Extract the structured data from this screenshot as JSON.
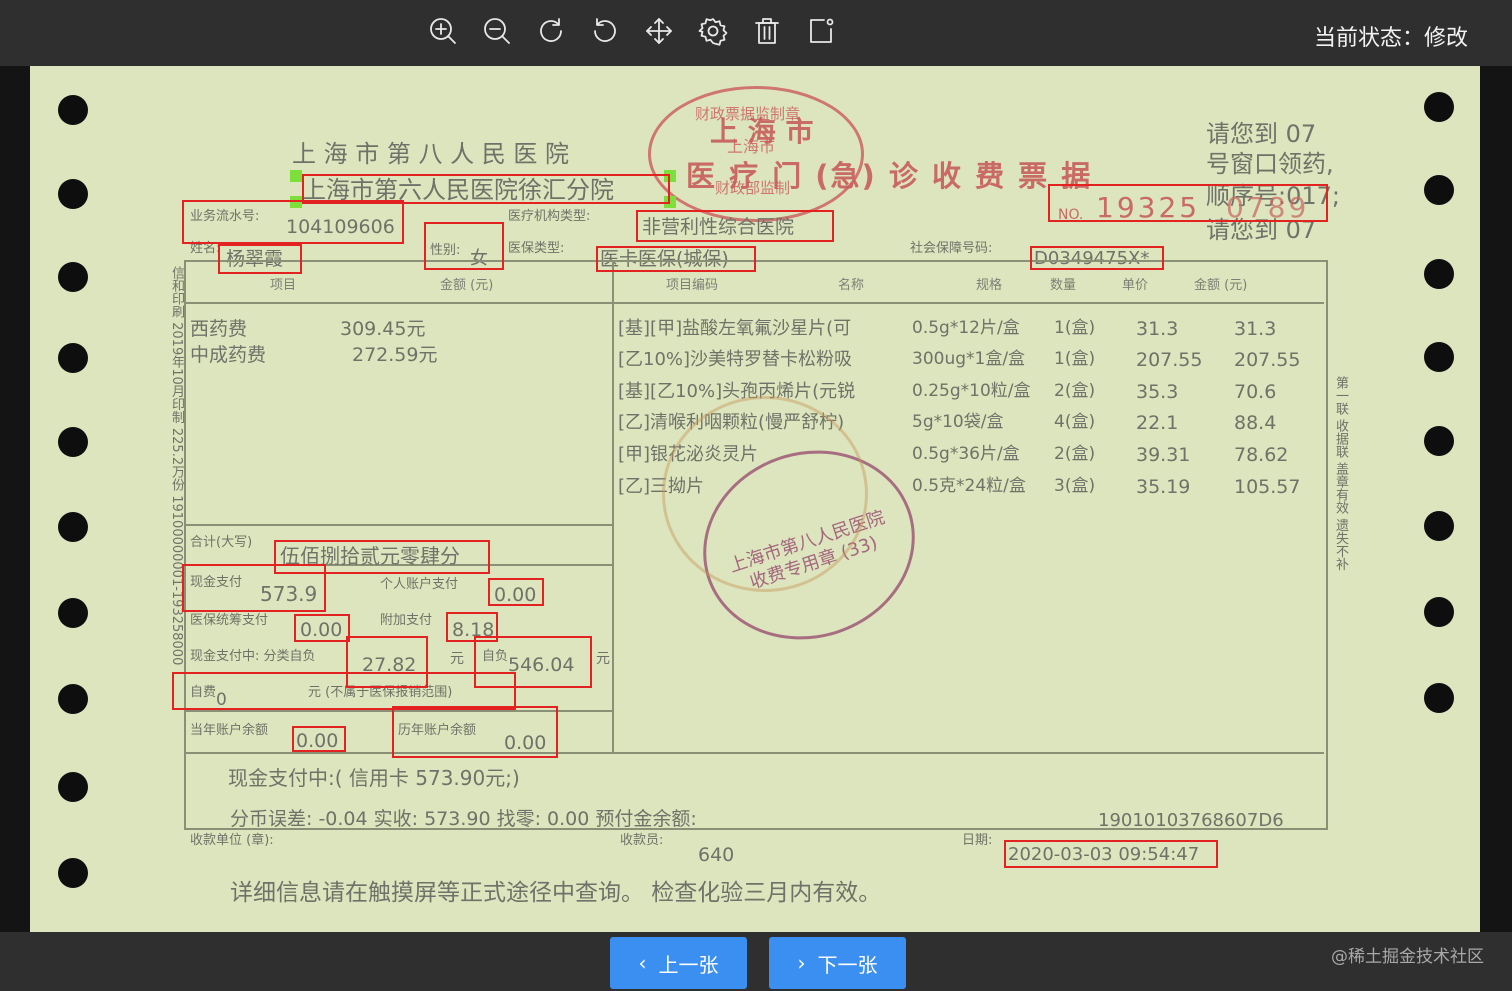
{
  "toolbar": {
    "icons": [
      "zoom-in-icon",
      "zoom-out-icon",
      "rotate-clockwise-icon",
      "rotate-counterclockwise-icon",
      "move-icon",
      "settings-icon",
      "delete-icon",
      "edit-icon"
    ],
    "status_label": "当前状态：修改"
  },
  "receipt": {
    "hospital_name": "上 海 市 第 八 人 民 医 院",
    "branch_name": "上海市第六人民医院徐汇分院",
    "title": "医 疗 门 (急) 诊 收 费 票 据",
    "city_stamp_top": "财政票据监制章",
    "city_stamp_mid": "上海市",
    "city_stamp_bot": "财政部监制",
    "city_word": "上 海 市",
    "no_label": "NO.",
    "no_value": "19325",
    "no_value_tail": "0789",
    "window_note_1": "请您到 07",
    "window_note_2": "号窗口领药,",
    "window_note_3": "顺序号:017;",
    "window_note_4": "请您到 07",
    "serial_label": "业务流水号:",
    "serial_value": "104109606",
    "inst_type_label": "医疗机构类型:",
    "inst_type_value": "非营利性综合医院",
    "name_label": "姓名:",
    "name_value": "杨翠霞",
    "gender_label": "性别:",
    "gender_value": "女",
    "insurance_type_label": "医保类型:",
    "insurance_type_value": "医卡医保(城保)",
    "social_no_label": "社会保障号码:",
    "social_no_value": "D0349475X*",
    "left_headers": [
      "项目",
      "金额 (元)"
    ],
    "right_headers": [
      "项目编码",
      "名称",
      "规格",
      "数量",
      "单价",
      "金额 (元)"
    ],
    "fee_items": [
      {
        "name": "西药费",
        "amount": "309.45元"
      },
      {
        "name": "中成药费",
        "amount": "272.59元"
      }
    ],
    "drug_rows": [
      {
        "name": "[基][甲]盐酸左氧氟沙星片(可",
        "spec": "0.5g*12片/盒",
        "qty": "1(盒)",
        "price": "31.3",
        "amount": "31.3"
      },
      {
        "name": "[乙10%]沙美特罗替卡松粉吸",
        "spec": "300ug*1盒/盒",
        "qty": "1(盒)",
        "price": "207.55",
        "amount": "207.55"
      },
      {
        "name": "[基][乙10%]头孢丙烯片(元锐",
        "spec": "0.25g*10粒/盒",
        "qty": "2(盒)",
        "price": "35.3",
        "amount": "70.6"
      },
      {
        "name": "[乙]清喉利咽颗粒(慢严舒柠)",
        "spec": "5g*10袋/盒",
        "qty": "4(盒)",
        "price": "22.1",
        "amount": "88.4"
      },
      {
        "name": "[甲]银花泌炎灵片",
        "spec": "0.5g*36片/盒",
        "qty": "2(盒)",
        "price": "39.31",
        "amount": "78.62"
      },
      {
        "name": "[乙]三拗片",
        "spec": "0.5克*24粒/盒",
        "qty": "3(盒)",
        "price": "35.19",
        "amount": "105.57"
      }
    ],
    "total_caps_label": "合计(大写)",
    "total_caps_value": "伍佰捌拾贰元零肆分",
    "cash_label": "现金支付",
    "cash_value": "573.9",
    "personal_acct_label": "个人账户支付",
    "personal_acct_value": "0.00",
    "insurance_pay_label": "医保统筹支付",
    "insurance_pay_value": "0.00",
    "additional_label": "附加支付",
    "additional_value": "8.18",
    "cash_in_label": "现金支付中: 分类自负",
    "class_self_value": "27.82",
    "yuan": "元",
    "self_label": "自负",
    "self_value": "546.04",
    "self_pay_label": "自费",
    "self_pay_value": "0",
    "self_pay_note": "元 (不属于医保报销范围)",
    "curr_acct_label": "当年账户余额",
    "curr_acct_value": "0.00",
    "prev_acct_label": "历年账户余额",
    "prev_acct_value": "0.00",
    "cash_note": "现金支付中:( 信用卡  573.90元;)",
    "rounding_note": "分币误差: -0.04 实收: 573.90  找零: 0.00 预付金余额:",
    "code_number": "19010103768607D6",
    "payee_unit_label": "收款单位 (章):",
    "payee_label": "收款员:",
    "payee_value": "640",
    "date_label": "日期:",
    "date_value": "2020-03-03 09:54:47",
    "footer_note": "详细信息请在触摸屏等正式途径中查询。   检查化验三月内有效。",
    "side_left": "信和印刷  2019年10月印制  225.2万份  19100000001-193258000",
    "side_right": "第一联  收据联  盖章有效  遗失不补",
    "center_stamp": "上海市第八人民医院 收费专用章 (33)"
  },
  "nav": {
    "prev_label": "上一张",
    "next_label": "下一张"
  },
  "watermark": "@稀土掘金技术社区"
}
